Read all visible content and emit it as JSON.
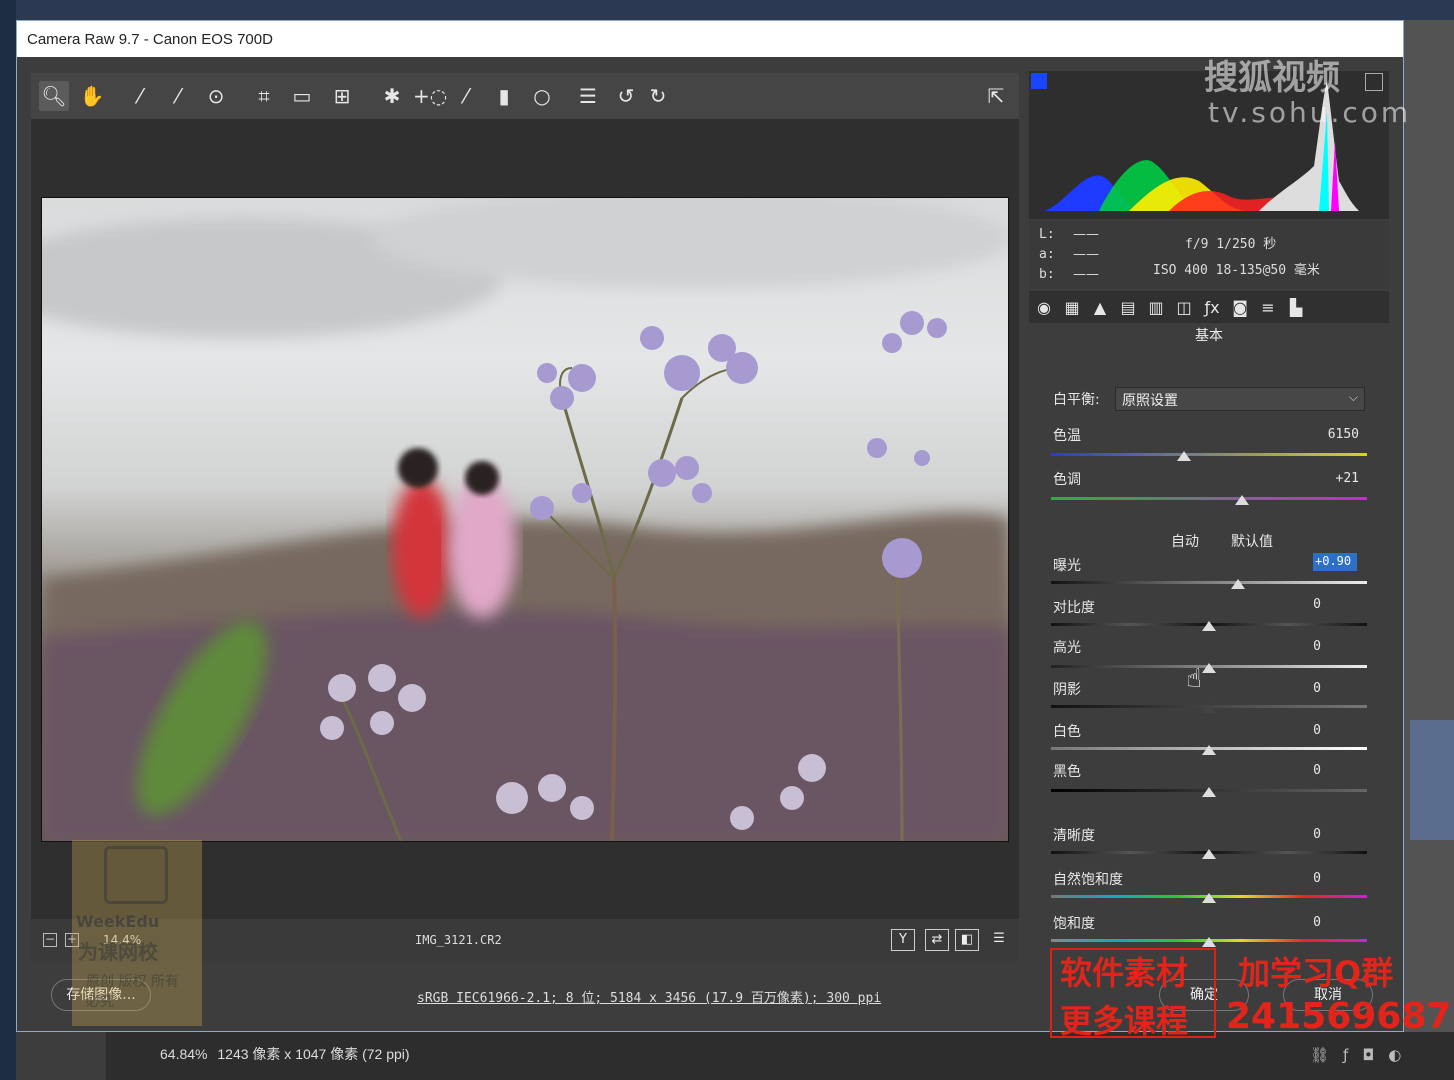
{
  "window": {
    "title": "Camera Raw 9.7 -  Canon EOS 700D"
  },
  "toolbar": {
    "icons": [
      "zoom-icon",
      "hand-icon",
      "white-balance-icon",
      "color-sampler-icon",
      "targeted-adjustment-icon",
      "crop-icon",
      "straighten-icon",
      "transform-icon",
      "spot-removal-icon",
      "red-eye-icon",
      "adjustment-brush-icon",
      "graduated-filter-icon",
      "radial-filter-icon",
      "preferences-icon",
      "rotate-left-icon",
      "rotate-right-icon",
      "fullscreen-icon"
    ]
  },
  "preview": {
    "zoom": "14.4%",
    "filename": "IMG_3121.CR2",
    "footer_buttons": [
      "Y",
      "⇄",
      "◧",
      "☰"
    ]
  },
  "readout": {
    "labels": [
      "L:",
      "a:",
      "b:"
    ],
    "dash": "——",
    "exif_line1": "f/9  1/250 秒",
    "exif_line2": "ISO 400  18-135@50 毫米"
  },
  "panel": {
    "name": "基本",
    "white_balance_label": "白平衡:",
    "white_balance_value": "原照设置",
    "temp_label": "色温",
    "temp_value": "6150",
    "tint_label": "色调",
    "tint_value": "+21",
    "auto_label": "自动",
    "default_label": "默认值",
    "exposure_label": "曝光",
    "exposure_value": "+0.90",
    "contrast_label": "对比度",
    "contrast_value": "0",
    "highlights_label": "高光",
    "highlights_value": "0",
    "shadows_label": "阴影",
    "shadows_value": "0",
    "whites_label": "白色",
    "whites_value": "0",
    "blacks_label": "黑色",
    "blacks_value": "0",
    "clarity_label": "清晰度",
    "clarity_value": "0",
    "vibrance_label": "自然饱和度",
    "vibrance_value": "0",
    "saturation_label": "饱和度",
    "saturation_value": "0"
  },
  "footer": {
    "save_label": "存储图像...",
    "workflow_text": "sRGB IEC61966-2.1; 8 位; 5184 x 3456 (17.9 百万像素); 300 ppi",
    "ok_label": "确定",
    "cancel_label": "取消"
  },
  "photoshop_status": {
    "zoom": "64.84%",
    "doc_size": "1243 像素 x 1047 像素 (72 ppi)"
  },
  "watermarks": {
    "sohu": "搜狐视频",
    "sohu_url": "tv.sohu.com",
    "weekedu": "WeekEdu",
    "weekedu_cn": "为课网校",
    "weekedu_note": "原创 版权 所有 必究",
    "promo1": "软件素材",
    "promo2": "更多课程",
    "promo3": "加学习Q群",
    "promo4": "241569687"
  },
  "colors": {
    "accent": "#2b6fc6",
    "promo": "#e3241b"
  }
}
